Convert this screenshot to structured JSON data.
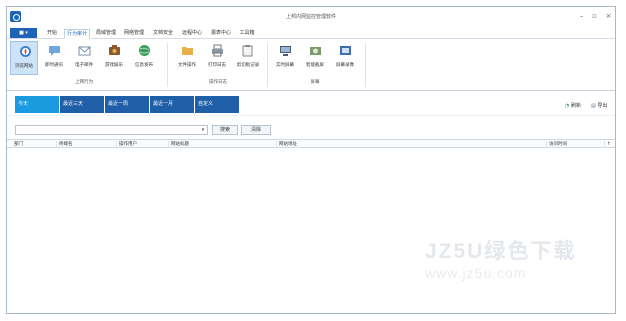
{
  "window": {
    "title": "上邦内网监控管理软件"
  },
  "menu": {
    "app_button": "■ ▾",
    "items": [
      "开始",
      "行为审计",
      "局域管理",
      "网络管理",
      "文档安全",
      "远程中心",
      "报表中心",
      "工具箱"
    ],
    "active_index": 1
  },
  "ribbon": {
    "groups": [
      {
        "label": "上网行为",
        "buttons": [
          "浏览网站",
          "即时通讯",
          "电子邮件",
          "游戏娱乐",
          "信息发布"
        ]
      },
      {
        "label": "操作日志",
        "buttons": [
          "文件操作",
          "打印日志",
          "剪切板记录"
        ]
      },
      {
        "label": "屏幕",
        "buttons": [
          "实时屏幕",
          "智能截屏",
          "屏幕录像"
        ]
      }
    ],
    "icons": [
      "compass-icon",
      "chat-icon",
      "mail-icon",
      "game-icon",
      "globe-icon",
      "folder-icon",
      "printer-icon",
      "clipboard-icon",
      "monitor-icon",
      "camera-icon",
      "film-icon"
    ]
  },
  "filters": {
    "date_tabs": [
      "今天",
      "最近三天",
      "最近一周",
      "最近一月",
      "自定义"
    ],
    "active_index": 0,
    "refresh": "刷新",
    "export": "导出"
  },
  "search": {
    "value": "",
    "dropdown_glyph": "▾",
    "search_label": "搜索",
    "clear_label": "清除"
  },
  "table": {
    "columns": [
      "部门",
      "终端名",
      "操作用户",
      "网站标题",
      "网站地址",
      "访问时间",
      "↑"
    ]
  },
  "watermark": {
    "line1": "JZ5U绿色下载",
    "line2": "www.jz5u.com"
  },
  "colors": {
    "accent": "#1e63b5",
    "tab_dark": "#1e5fa8",
    "tab_active": "#1a9be0",
    "ribbon_active": "#cde3f7"
  }
}
